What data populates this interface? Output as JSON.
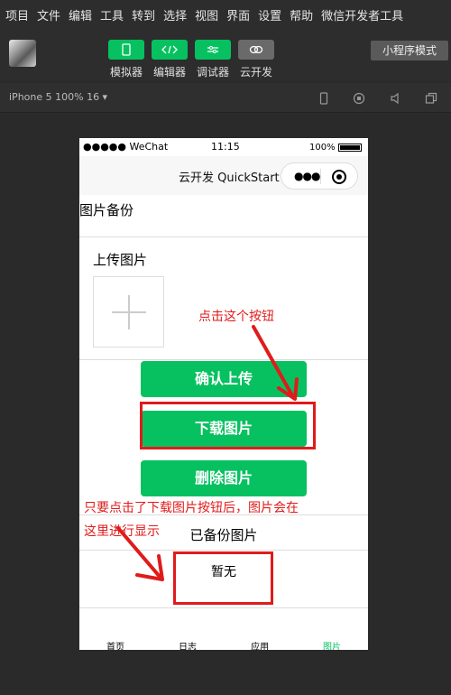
{
  "menu": [
    "项目",
    "文件",
    "编辑",
    "工具",
    "转到",
    "选择",
    "视图",
    "界面",
    "设置",
    "帮助",
    "微信开发者工具"
  ],
  "toolbar": {
    "tools": [
      {
        "label": "模拟器",
        "icon": "phone-icon"
      },
      {
        "label": "编辑器",
        "icon": "code-icon"
      },
      {
        "label": "调试器",
        "icon": "debug-icon"
      },
      {
        "label": "云开发",
        "icon": "cloud-icon"
      }
    ],
    "mode": "小程序模式"
  },
  "device": {
    "select": "iPhone 5 100% 16 ▾"
  },
  "phone": {
    "status": {
      "carrier": "●●●●● WeChat",
      "time": "11:15",
      "battery": "100%"
    },
    "nav_title": "云开发 QuickStart",
    "capsule_dots": "●●●",
    "section_title": "图片备份",
    "upload_label": "上传图片",
    "buttons": {
      "confirm": "确认上传",
      "download": "下载图片",
      "delete": "删除图片"
    },
    "backup_label": "已备份图片",
    "empty_text": "暂无",
    "tabs": [
      "首页",
      "日志",
      "应用",
      "图片"
    ]
  },
  "annotations": {
    "click_hint": "点击这个按钮",
    "display_hint_line1": "只要点击了下载图片按钮后，图片会在",
    "display_hint_line2": "这里进行显示"
  },
  "colors": {
    "accent": "#07c160",
    "annotation": "#e01b1b"
  }
}
